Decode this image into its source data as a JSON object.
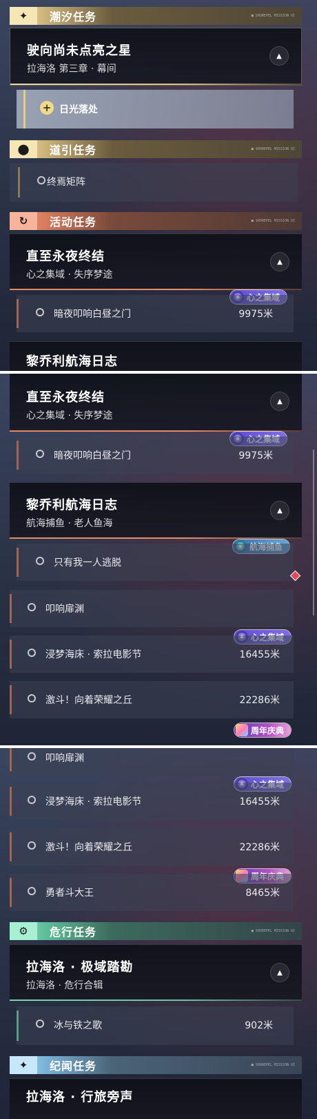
{
  "sections": {
    "tide": {
      "title": "潮汐任务",
      "icon": "sparkle-icon"
    },
    "guide": {
      "title": "道引任务",
      "icon": "location-pin-icon"
    },
    "event": {
      "title": "活动任务",
      "icon": "refresh-icon"
    },
    "danger": {
      "title": "危行任务",
      "icon": "alert-gear-icon"
    },
    "chronicle": {
      "title": "纪闻任务",
      "icon": "sparkle-icon"
    }
  },
  "header_tail": "■ SHOREPEL MISSION UI",
  "chevron": "▲",
  "plus": "+",
  "panel1": {
    "tide_card": {
      "title": "驶向尚未点亮之星",
      "subtitle": "拉海洛 第三章 · 幕间"
    },
    "tide_task": {
      "label": "日光落处"
    },
    "guide_task": {
      "label": "终焉矩阵"
    },
    "event_card": {
      "title": "直至永夜终结",
      "subtitle": "心之集域 · 失序梦途"
    },
    "event_task": {
      "label": "暗夜叩响白昼之门",
      "distance": "9975米",
      "tag": "心之集域"
    },
    "next_card_peek": {
      "title": "黎乔利航海日志"
    }
  },
  "panel2": {
    "card1": {
      "title": "直至永夜终结",
      "subtitle": "心之集域 · 失序梦途"
    },
    "task1": {
      "label": "暗夜叩响白昼之门",
      "distance": "9975米",
      "tag": "心之集域"
    },
    "card2": {
      "title": "黎乔利航海日志",
      "subtitle": "航海捕鱼 · 老人鱼海"
    },
    "task2": {
      "label": "只有我一人逃脱",
      "tag": "航海捕鱼"
    },
    "task3": {
      "label": "叩响扉渊"
    },
    "task4": {
      "label": "浸梦海床 · 索拉电影节",
      "distance": "16455米",
      "tag": "心之集域"
    },
    "task5": {
      "label": "激斗！向着荣耀之丘",
      "distance": "22286米",
      "tag": "周年庆典"
    }
  },
  "panel3": {
    "task1": {
      "label": "叩响扉渊"
    },
    "task2": {
      "label": "浸梦海床 · 索拉电影节",
      "distance": "16455米",
      "tag": "心之集域"
    },
    "task3": {
      "label": "激斗！向着荣耀之丘",
      "distance": "22286米"
    },
    "task4": {
      "label": "勇者斗大王",
      "distance": "8465米",
      "tag": "周年庆典"
    },
    "danger_card": {
      "title": "拉海洛 · 极域踏勘",
      "subtitle": "拉海洛 · 危行合辑"
    },
    "danger_task": {
      "label": "冰与铁之歌",
      "distance": "902米"
    },
    "chronicle_card": {
      "title": "拉海洛 · 行旅旁声"
    }
  }
}
